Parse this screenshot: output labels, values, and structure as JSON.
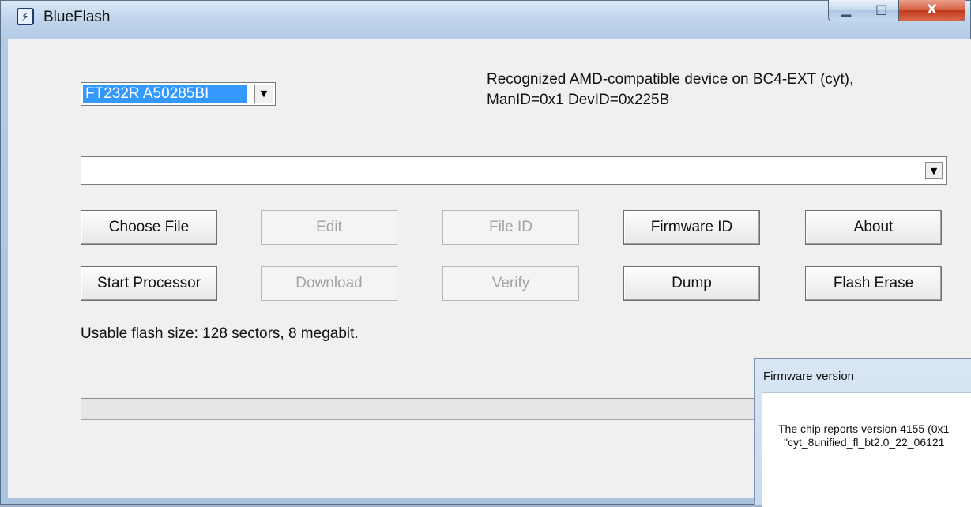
{
  "window": {
    "title": "BlueFlash",
    "icon": "blueflash-app-icon",
    "controls": {
      "minimize_glyph": "▁",
      "maximize_glyph": "□",
      "close_glyph": "X"
    }
  },
  "device": {
    "selected": "FT232R A50285BI",
    "dropdown_glyph": "▼"
  },
  "status": {
    "line1": "Recognized AMD-compatible device on BC4-EXT (cyt),",
    "line2": "ManID=0x1 DevID=0x225B"
  },
  "file_combo": {
    "value": "",
    "dropdown_glyph": "▼"
  },
  "buttons": {
    "choose_file": "Choose File",
    "edit": "Edit",
    "file_id": "File ID",
    "firmware_id": "Firmware ID",
    "about": "About",
    "start_processor": "Start Processor",
    "download": "Download",
    "verify": "Verify",
    "dump": "Dump",
    "flash_erase": "Flash Erase"
  },
  "flash_info": "Usable flash size: 128 sectors, 8 megabit.",
  "progress": {
    "value": 0
  },
  "firmware_dialog": {
    "title": "Firmware version",
    "message_line1": "The chip reports version 4155 (0x1",
    "message_line2": "\"cyt_8unified_fl_bt2.0_22_06121"
  }
}
